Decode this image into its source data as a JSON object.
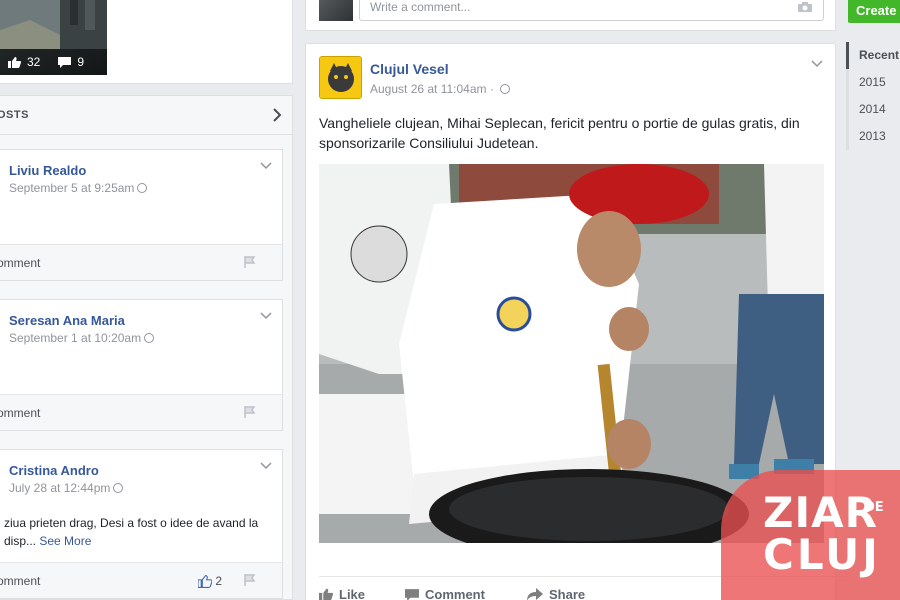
{
  "left": {
    "photo_stats": {
      "likes": "32",
      "comments": "9"
    },
    "posts_header": "OSTS",
    "posts": [
      {
        "author": "Liviu Realdo",
        "time": "September 5 at 9:25am",
        "comment": "omment"
      },
      {
        "author": "Seresan Ana Maria",
        "time": "September 1 at 10:20am",
        "comment": "omment"
      },
      {
        "author": "Cristina Andro",
        "time": "July 28 at 12:44pm",
        "text": "ziua prieten drag, Desi a fost o idee de avand la disp...",
        "see_more": "See More",
        "likes": "2",
        "comment": "omment"
      }
    ]
  },
  "composer": {
    "placeholder": "Write a comment..."
  },
  "post": {
    "page_name": "Clujul Vesel",
    "time": "August 26 at 11:04am",
    "text": "Vangheliele clujean, Mihai Seplecan, fericit pentru o portie de gulas gratis, din sponsorizarile Consiliului Judetean.",
    "actions": {
      "like": "Like",
      "comment": "Comment",
      "share": "Share"
    }
  },
  "right": {
    "create_label": "Create",
    "years": [
      "Recent",
      "2015",
      "2014",
      "2013"
    ]
  },
  "watermark": {
    "line1": "ZIAR",
    "small": "DE",
    "line2": "CLUJ"
  },
  "colors": {
    "link": "#365899",
    "background": "#e9ebee",
    "create": "#42b72a",
    "watermark": "#e95050"
  }
}
